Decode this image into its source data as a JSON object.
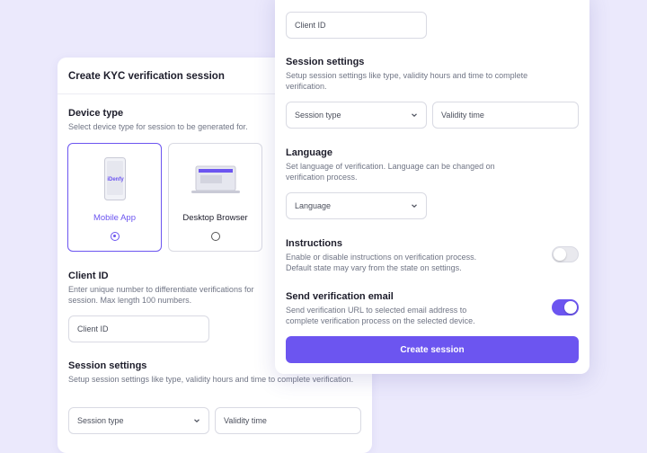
{
  "colors": {
    "background": "#ebe9fc",
    "accent": "#6c55f0",
    "panel": "#ffffff"
  },
  "back": {
    "title": "Create KYC verification session",
    "device_type": {
      "title": "Device type",
      "desc": "Select device type for session to be generated for.",
      "options": [
        {
          "label": "Mobile App",
          "brand": "iDenfy",
          "icon": "mobile-phone-icon",
          "selected": true
        },
        {
          "label": "Desktop Browser",
          "icon": "laptop-icon",
          "selected": false
        }
      ]
    },
    "client_id": {
      "title": "Client ID",
      "desc": "Enter unique number to differentiate verifications for session. Max length 100 numbers.",
      "placeholder": "Client ID"
    },
    "session_settings": {
      "title": "Session settings",
      "desc": "Setup session settings like type, validity hours and time to complete verification.",
      "type_placeholder": "Session type",
      "validity_placeholder": "Validity time"
    }
  },
  "front": {
    "client_id_placeholder": "Client ID",
    "session_settings": {
      "title": "Session settings",
      "desc": "Setup session settings like type, validity hours and time to complete verification.",
      "type_placeholder": "Session type",
      "validity_placeholder": "Validity time"
    },
    "language": {
      "title": "Language",
      "desc": "Set language of verification. Language can be changed on verification process.",
      "placeholder": "Language"
    },
    "instructions": {
      "title": "Instructions",
      "desc": "Enable or disable instructions on verification process. Default state may vary from the state on settings.",
      "enabled": false
    },
    "email": {
      "title": "Send verification email",
      "desc": "Send verification URL to selected email address to complete verification process on the selected device.",
      "enabled": true
    },
    "create_label": "Create session"
  }
}
